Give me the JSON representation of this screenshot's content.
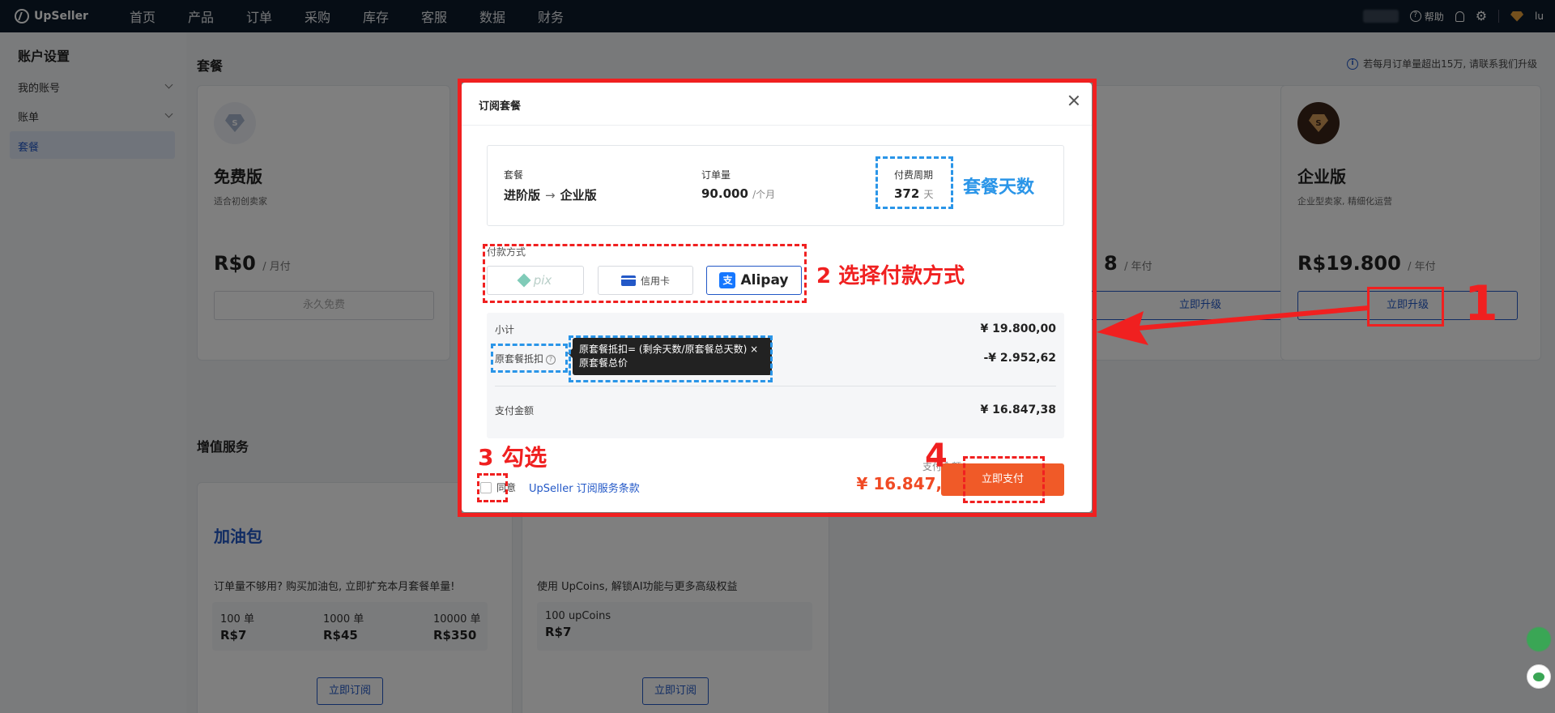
{
  "nav": {
    "logo": "UpSeller",
    "items": [
      "首页",
      "产品",
      "订单",
      "采购",
      "库存",
      "客服",
      "数据",
      "财务"
    ],
    "help": "帮助",
    "user": "lu"
  },
  "sidebar": {
    "title": "账户设置",
    "items": [
      {
        "label": "我的账号"
      },
      {
        "label": "账单"
      },
      {
        "label": "套餐"
      }
    ]
  },
  "main": {
    "plan_heading": "套餐",
    "top_note": "若每月订单量超出15万, 请联系我们升级",
    "free_card": {
      "title": "免费版",
      "sub": "适合初创卖家",
      "price": "R$0",
      "period": "/ 月付",
      "button": "永久免费"
    },
    "partial_card": {
      "price_tail": "8",
      "period": "/ 年付",
      "button": "立即升级"
    },
    "enterprise_card": {
      "title": "企业版",
      "sub": "企业型卖家, 精细化运营",
      "price": "R$19.800",
      "period": "/ 年付",
      "button": "立即升级"
    },
    "vas_heading": "增值服务",
    "fuel_pack": {
      "title": "加油包",
      "desc": "订单量不够用? 购买加油包, 立即扩充本月套餐单量!",
      "options": [
        {
          "qty": "100 单",
          "price": "R$7"
        },
        {
          "qty": "1000 单",
          "price": "R$45"
        },
        {
          "qty": "10000 单",
          "price": "R$350"
        }
      ],
      "button": "立即订阅"
    },
    "upcoins": {
      "desc": "使用 UpCoins, 解锁AI功能与更多高级权益",
      "option": {
        "qty": "100 upCoins",
        "price": "R$7"
      },
      "button": "立即订阅"
    }
  },
  "modal": {
    "title": "订阅套餐",
    "plan_label": "套餐",
    "plan_from": "进阶版",
    "plan_to": "企业版",
    "orders_label": "订单量",
    "orders_value": "90.000",
    "orders_unit": "/个月",
    "period_label": "付费周期",
    "period_value": "372",
    "period_unit": "天",
    "payment_label": "付款方式",
    "payment_methods": [
      {
        "label": "pix",
        "icon": "pix-icon"
      },
      {
        "label": "信用卡",
        "icon": "credit-card-icon"
      },
      {
        "label": "Alipay",
        "icon": "alipay-icon",
        "selected": true
      }
    ],
    "subtotal_label": "小计",
    "subtotal_value": "¥ 19.800,00",
    "deduction_label": "原套餐抵扣",
    "deduction_value": "-¥ 2.952,62",
    "tooltip": "原套餐抵扣= (剩余天数/原套餐总天数) × 原套餐总价",
    "pay_label": "支付金额",
    "pay_value": "¥ 16.847,38",
    "agree_label": "同意",
    "agree_link": "UpSeller 订阅服务条款",
    "footer_pay_label": "支付金额",
    "footer_pay_value": "¥ 16.847,38",
    "pay_button": "立即支付"
  },
  "annotations": {
    "days": "套餐天数",
    "step1": "1",
    "step2": "2 选择付款方式",
    "step3": "3 勾选",
    "step4": "4"
  },
  "colors": {
    "brand_blue": "#2358c7",
    "pay_orange": "#f05a28",
    "annotation_red": "#f02020",
    "annotation_blue": "#2a95e8"
  }
}
